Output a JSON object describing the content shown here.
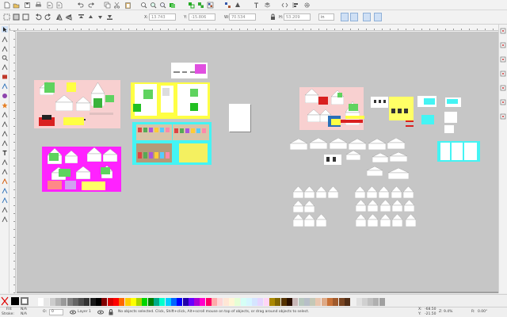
{
  "controls": {
    "x_label": "X:",
    "x_value": "13.743",
    "y_label": "Y:",
    "y_value": "-15.806",
    "w_label": "W:",
    "w_value": "70.534",
    "h_label": "H:",
    "h_value": "53.209",
    "unit": "in"
  },
  "status": {
    "fill_label": "Fill:",
    "fill_value": "N/A",
    "stroke_label": "Stroke:",
    "stroke_value": "N/A",
    "opacity_label": "O:",
    "opacity_value": "0",
    "layer": "Layer 1",
    "message": "No objects selected. Click, Shift+click, Alt+scroll mouse on top of objects, or drag around objects to select.",
    "cursor_x_label": "X:",
    "cursor_x": "-68.50",
    "cursor_y_label": "Y:",
    "cursor_y": "-21.50",
    "zoom_label": "Z:",
    "zoom": "9.4%",
    "rotation_label": "R:",
    "rotation": "0.00°"
  },
  "icons": {
    "command_bar": [
      "new-document-icon",
      "open-icon",
      "save-icon",
      "print-icon",
      "import-icon",
      "export-icon",
      "undo-icon",
      "redo-icon",
      "copy-icon",
      "cut-icon",
      "paste-icon",
      "zoom-selection-icon",
      "zoom-drawing-icon",
      "zoom-page-icon",
      "duplicate-icon",
      "clone-icon",
      "unlink-clone-icon",
      "group-icon",
      "ungroup-icon",
      "fill-stroke-icon",
      "text-font-icon",
      "layers-icon",
      "xml-editor-icon",
      "align-icon",
      "preferences-icon"
    ],
    "tools": [
      "selector-icon",
      "node-icon",
      "tweak-icon",
      "zoom-icon",
      "measure-icon",
      "rectangle-icon",
      "3d-box-icon",
      "ellipse-icon",
      "star-icon",
      "spiral-icon",
      "pencil-icon",
      "pen-icon",
      "calligraphy-icon",
      "text-icon",
      "spray-icon",
      "eraser-icon",
      "bucket-icon",
      "gradient-icon",
      "mesh-icon",
      "dropper-icon",
      "connector-icon"
    ]
  },
  "colors": {
    "canvas": "#c6c6c6",
    "page_pink": "#f8d0d0",
    "page_yellow": "#ffff44",
    "page_cyan": "#44f4f4",
    "page_magenta": "#ff22ff",
    "palette": [
      "#ffffff",
      "#e6e6e6",
      "#cccccc",
      "#b3b3b3",
      "#999999",
      "#808080",
      "#666666",
      "#4d4d4d",
      "#333333",
      "#1a1a1a",
      "#000000",
      "#800000",
      "#d40000",
      "#ff0000",
      "#ff6600",
      "#ffcc00",
      "#ffff00",
      "#aad400",
      "#00d400",
      "#008000",
      "#00aa88",
      "#00ffcc",
      "#00ccff",
      "#0066ff",
      "#0000ff",
      "#2200aa",
      "#6600ff",
      "#aa00d4",
      "#ff00cc",
      "#ff0066",
      "#ffaaaa",
      "#ffd5d5",
      "#ffe6d5",
      "#fff6d5",
      "#e5ffd5",
      "#d5fff6",
      "#d5f6ff",
      "#d5e5ff",
      "#e5d5ff",
      "#ffd5f6",
      "#aa8800",
      "#806600",
      "#553300",
      "#2b1100",
      "#c8b7b7",
      "#b7c8be",
      "#b7bec8",
      "#c4c8b7",
      "#e9c6af",
      "#deaa87",
      "#c87137",
      "#a05a2c",
      "#784421",
      "#502d16",
      "#f0f0f0",
      "#e0e0e0",
      "#d0d0d0",
      "#c0c0c0",
      "#b0b0b0",
      "#a0a0a0"
    ]
  }
}
